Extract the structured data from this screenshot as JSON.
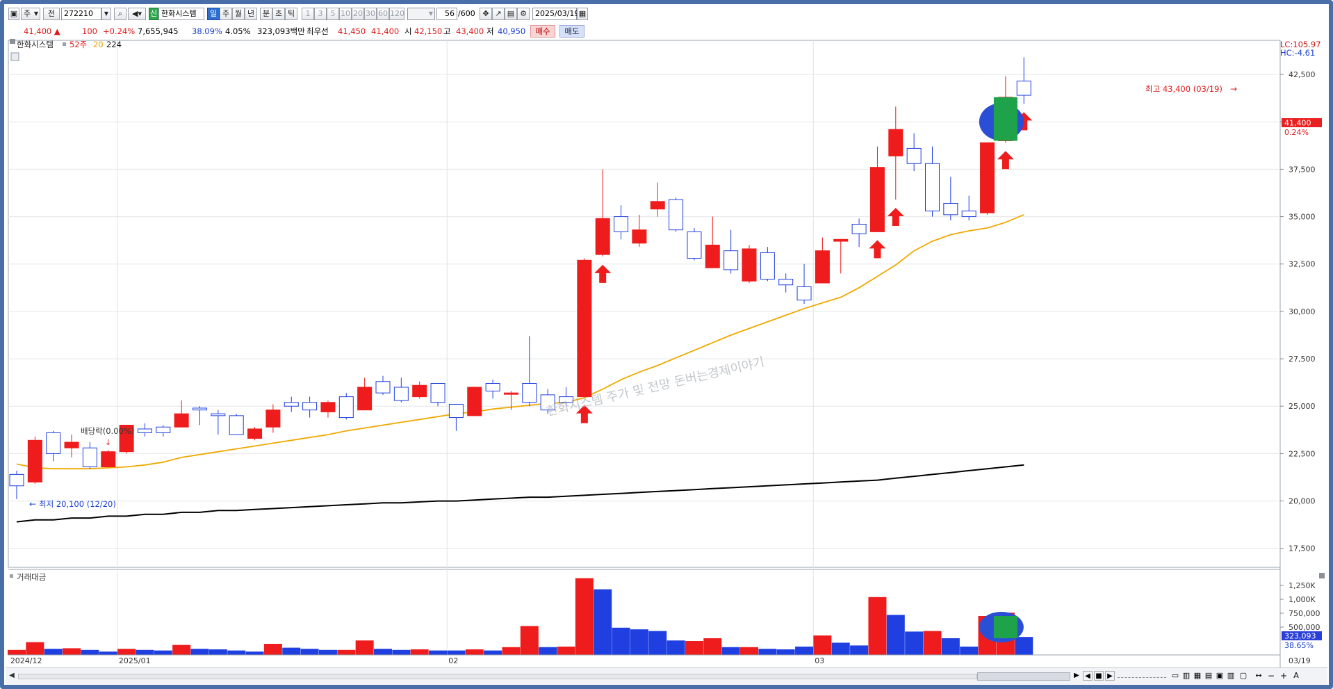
{
  "toolbar": {
    "period_label": "주",
    "market_label": "전",
    "stock_code": "272210",
    "new_badge": "신",
    "stock_name": "한화시스템",
    "timeframes": [
      "일",
      "주",
      "월",
      "년",
      "분",
      "초",
      "틱"
    ],
    "selected_timeframe": "일",
    "intervals": [
      "1",
      "3",
      "5",
      "10",
      "20",
      "30",
      "60",
      "120"
    ],
    "count": "56",
    "count_max": "/600",
    "date": "2025/03/19"
  },
  "quote": {
    "price": "41,400 ▲",
    "change": "100",
    "change_pct": "+0.24%",
    "volume": "7,655,945",
    "volume_ratio": "38.09%",
    "turnover": "4.05%",
    "trade_amount": "323,093백만",
    "priority_label": "최우선",
    "ask": "41,450",
    "bid": "41,400",
    "open_label": "시",
    "open": "42,150",
    "high_label": "고",
    "high": "43,400",
    "low_label": "저",
    "low": "40,950",
    "buy_label": "매수",
    "sell_label": "매도"
  },
  "legend": {
    "stock_name": "한화시스템",
    "series": [
      "52주",
      "20",
      "224"
    ],
    "lc": "LC:105.97",
    "hc": "HC:-4.61"
  },
  "volume_panel": {
    "title": "거래대금",
    "ticks": [
      "1,250K",
      "1,000K",
      "750,000",
      "500,000"
    ],
    "current_value": "323,093",
    "current_pct": "38.65%"
  },
  "annotations": {
    "high_label": "최고 43,400 (03/19)",
    "low_label": "최저 20,100 (12/20)",
    "dividend_label": "배당락(0.00%)",
    "watermark": "한화시스템 주가 및 전망 돈버는경제이야기",
    "price_tag": "41,400",
    "price_tag_pct": "0.24%"
  },
  "colors": {
    "up": "#ee1c1c",
    "down": "#1f3fe0",
    "ma20": "#f0a800",
    "ma224": "#000000",
    "highlight_fill": "#1fa34a",
    "highlight_ring": "#2a4fd6"
  },
  "chart_data": {
    "type": "candlestick",
    "title": "한화시스템",
    "ylim": [
      16500,
      44300
    ],
    "y_ticks": [
      17500,
      20000,
      22500,
      25000,
      27500,
      30000,
      32500,
      35000,
      37500,
      40000,
      42500
    ],
    "x_labels": [
      "2024/12",
      "2025/01",
      "02",
      "03",
      "03/19"
    ],
    "candles": [
      {
        "o": 20800,
        "h": 21600,
        "l": 20100,
        "c": 21400,
        "dir": "down"
      },
      {
        "o": 21000,
        "h": 23400,
        "l": 20900,
        "c": 23200,
        "dir": "up"
      },
      {
        "o": 22500,
        "h": 23700,
        "l": 22100,
        "c": 23600,
        "dir": "down"
      },
      {
        "o": 22800,
        "h": 23500,
        "l": 22300,
        "c": 23100,
        "dir": "up"
      },
      {
        "o": 21800,
        "h": 23100,
        "l": 21700,
        "c": 22800,
        "dir": "down"
      },
      {
        "o": 21800,
        "h": 22700,
        "l": 21800,
        "c": 22600,
        "dir": "up"
      },
      {
        "o": 22600,
        "h": 24000,
        "l": 22500,
        "c": 24000,
        "dir": "up"
      },
      {
        "o": 23600,
        "h": 24100,
        "l": 23400,
        "c": 23800,
        "dir": "down"
      },
      {
        "o": 23600,
        "h": 24000,
        "l": 23400,
        "c": 23900,
        "dir": "down"
      },
      {
        "o": 23900,
        "h": 25300,
        "l": 23900,
        "c": 24600,
        "dir": "up"
      },
      {
        "o": 24800,
        "h": 25000,
        "l": 24000,
        "c": 24900,
        "dir": "down"
      },
      {
        "o": 24500,
        "h": 24800,
        "l": 23500,
        "c": 24600,
        "dir": "down"
      },
      {
        "o": 23500,
        "h": 24600,
        "l": 23500,
        "c": 24500,
        "dir": "down"
      },
      {
        "o": 23300,
        "h": 23900,
        "l": 23200,
        "c": 23800,
        "dir": "up"
      },
      {
        "o": 23900,
        "h": 25100,
        "l": 23600,
        "c": 24800,
        "dir": "up"
      },
      {
        "o": 25000,
        "h": 25500,
        "l": 24700,
        "c": 25200,
        "dir": "down"
      },
      {
        "o": 24800,
        "h": 25500,
        "l": 24400,
        "c": 25200,
        "dir": "down"
      },
      {
        "o": 24700,
        "h": 25300,
        "l": 24400,
        "c": 25200,
        "dir": "up"
      },
      {
        "o": 24400,
        "h": 25700,
        "l": 24300,
        "c": 25500,
        "dir": "down"
      },
      {
        "o": 24800,
        "h": 26500,
        "l": 24800,
        "c": 26000,
        "dir": "up"
      },
      {
        "o": 25700,
        "h": 26600,
        "l": 25600,
        "c": 26300,
        "dir": "down"
      },
      {
        "o": 25300,
        "h": 26500,
        "l": 25200,
        "c": 26000,
        "dir": "down"
      },
      {
        "o": 25500,
        "h": 26300,
        "l": 25400,
        "c": 26100,
        "dir": "up"
      },
      {
        "o": 25200,
        "h": 26200,
        "l": 25000,
        "c": 26200,
        "dir": "down"
      },
      {
        "o": 24400,
        "h": 25000,
        "l": 23700,
        "c": 25100,
        "dir": "down"
      },
      {
        "o": 24500,
        "h": 26000,
        "l": 24500,
        "c": 26000,
        "dir": "up"
      },
      {
        "o": 25800,
        "h": 26400,
        "l": 25400,
        "c": 26200,
        "dir": "down"
      },
      {
        "o": 25700,
        "h": 25800,
        "l": 24800,
        "c": 25700,
        "dir": "up"
      },
      {
        "o": 25200,
        "h": 28700,
        "l": 25000,
        "c": 26200,
        "dir": "down"
      },
      {
        "o": 24800,
        "h": 25900,
        "l": 24600,
        "c": 25600,
        "dir": "down"
      },
      {
        "o": 25200,
        "h": 26000,
        "l": 25000,
        "c": 25500,
        "dir": "down"
      },
      {
        "o": 25500,
        "h": 32800,
        "l": 25500,
        "c": 32700,
        "dir": "up"
      },
      {
        "o": 33000,
        "h": 37500,
        "l": 32900,
        "c": 34900,
        "dir": "up"
      },
      {
        "o": 34200,
        "h": 35600,
        "l": 33800,
        "c": 35000,
        "dir": "down"
      },
      {
        "o": 34300,
        "h": 35100,
        "l": 33400,
        "c": 33600,
        "dir": "up"
      },
      {
        "o": 35400,
        "h": 36800,
        "l": 35000,
        "c": 35800,
        "dir": "up"
      },
      {
        "o": 34300,
        "h": 36000,
        "l": 34200,
        "c": 35900,
        "dir": "down"
      },
      {
        "o": 32800,
        "h": 34400,
        "l": 32700,
        "c": 34200,
        "dir": "down"
      },
      {
        "o": 33500,
        "h": 35000,
        "l": 32300,
        "c": 32300,
        "dir": "up"
      },
      {
        "o": 32200,
        "h": 34300,
        "l": 32000,
        "c": 33200,
        "dir": "down"
      },
      {
        "o": 33300,
        "h": 33500,
        "l": 31500,
        "c": 31600,
        "dir": "up"
      },
      {
        "o": 31700,
        "h": 33400,
        "l": 31600,
        "c": 33100,
        "dir": "down"
      },
      {
        "o": 31400,
        "h": 32000,
        "l": 31000,
        "c": 31700,
        "dir": "down"
      },
      {
        "o": 30600,
        "h": 32500,
        "l": 30400,
        "c": 31300,
        "dir": "down"
      },
      {
        "o": 31500,
        "h": 33900,
        "l": 31500,
        "c": 33200,
        "dir": "up"
      },
      {
        "o": 33700,
        "h": 33800,
        "l": 32000,
        "c": 33800,
        "dir": "up"
      },
      {
        "o": 34100,
        "h": 34900,
        "l": 33400,
        "c": 34600,
        "dir": "down"
      },
      {
        "o": 34200,
        "h": 38700,
        "l": 34200,
        "c": 37600,
        "dir": "up"
      },
      {
        "o": 38200,
        "h": 40800,
        "l": 35900,
        "c": 39600,
        "dir": "up"
      },
      {
        "o": 37800,
        "h": 39400,
        "l": 37400,
        "c": 38600,
        "dir": "down"
      },
      {
        "o": 35300,
        "h": 38700,
        "l": 35000,
        "c": 37800,
        "dir": "down"
      },
      {
        "o": 35100,
        "h": 37100,
        "l": 34800,
        "c": 35700,
        "dir": "down"
      },
      {
        "o": 35000,
        "h": 36100,
        "l": 34800,
        "c": 35300,
        "dir": "down"
      },
      {
        "o": 35200,
        "h": 38900,
        "l": 35100,
        "c": 38900,
        "dir": "up"
      },
      {
        "o": 39000,
        "h": 42400,
        "l": 38900,
        "c": 41300,
        "dir": "up"
      },
      {
        "o": 41400,
        "h": 43400,
        "l": 40950,
        "c": 42150,
        "dir": "down"
      }
    ],
    "ma20": [
      21950,
      21750,
      21700,
      21700,
      21700,
      21750,
      21800,
      21900,
      22050,
      22300,
      22450,
      22600,
      22750,
      22900,
      23050,
      23200,
      23350,
      23500,
      23700,
      23850,
      24000,
      24150,
      24300,
      24450,
      24600,
      24700,
      24850,
      24950,
      25050,
      25150,
      25200,
      25450,
      25900,
      26400,
      26800,
      27150,
      27550,
      27950,
      28350,
      28750,
      29100,
      29450,
      29800,
      30150,
      30450,
      30750,
      31250,
      31850,
      32450,
      33200,
      33700,
      34050,
      34250,
      34400,
      34700,
      35100
    ],
    "ma224": [
      18900,
      19000,
      19000,
      19100,
      19100,
      19200,
      19200,
      19300,
      19300,
      19400,
      19400,
      19500,
      19500,
      19550,
      19600,
      19650,
      19700,
      19750,
      19800,
      19850,
      19900,
      19900,
      19950,
      20000,
      20000,
      20050,
      20100,
      20150,
      20200,
      20200,
      20250,
      20300,
      20350,
      20400,
      20450,
      20500,
      20550,
      20600,
      20650,
      20700,
      20750,
      20800,
      20850,
      20900,
      20950,
      21000,
      21050,
      21100,
      21200,
      21300,
      21400,
      21500,
      21600,
      21700,
      21800,
      21900
    ],
    "volume": [
      {
        "v": 90000,
        "dir": "up"
      },
      {
        "v": 230000,
        "dir": "up"
      },
      {
        "v": 110000,
        "dir": "down"
      },
      {
        "v": 120000,
        "dir": "up"
      },
      {
        "v": 90000,
        "dir": "down"
      },
      {
        "v": 60000,
        "dir": "down"
      },
      {
        "v": 110000,
        "dir": "up"
      },
      {
        "v": 90000,
        "dir": "down"
      },
      {
        "v": 80000,
        "dir": "down"
      },
      {
        "v": 180000,
        "dir": "up"
      },
      {
        "v": 110000,
        "dir": "down"
      },
      {
        "v": 100000,
        "dir": "down"
      },
      {
        "v": 80000,
        "dir": "down"
      },
      {
        "v": 60000,
        "dir": "down"
      },
      {
        "v": 200000,
        "dir": "up"
      },
      {
        "v": 130000,
        "dir": "down"
      },
      {
        "v": 110000,
        "dir": "down"
      },
      {
        "v": 90000,
        "dir": "down"
      },
      {
        "v": 90000,
        "dir": "up"
      },
      {
        "v": 260000,
        "dir": "up"
      },
      {
        "v": 110000,
        "dir": "down"
      },
      {
        "v": 90000,
        "dir": "down"
      },
      {
        "v": 100000,
        "dir": "up"
      },
      {
        "v": 80000,
        "dir": "down"
      },
      {
        "v": 80000,
        "dir": "down"
      },
      {
        "v": 100000,
        "dir": "up"
      },
      {
        "v": 80000,
        "dir": "down"
      },
      {
        "v": 140000,
        "dir": "up"
      },
      {
        "v": 520000,
        "dir": "up"
      },
      {
        "v": 140000,
        "dir": "down"
      },
      {
        "v": 150000,
        "dir": "up"
      },
      {
        "v": 1380000,
        "dir": "up"
      },
      {
        "v": 1180000,
        "dir": "down"
      },
      {
        "v": 490000,
        "dir": "down"
      },
      {
        "v": 460000,
        "dir": "down"
      },
      {
        "v": 430000,
        "dir": "down"
      },
      {
        "v": 260000,
        "dir": "down"
      },
      {
        "v": 250000,
        "dir": "up"
      },
      {
        "v": 300000,
        "dir": "up"
      },
      {
        "v": 140000,
        "dir": "down"
      },
      {
        "v": 140000,
        "dir": "up"
      },
      {
        "v": 110000,
        "dir": "down"
      },
      {
        "v": 100000,
        "dir": "down"
      },
      {
        "v": 150000,
        "dir": "down"
      },
      {
        "v": 350000,
        "dir": "up"
      },
      {
        "v": 220000,
        "dir": "down"
      },
      {
        "v": 170000,
        "dir": "down"
      },
      {
        "v": 1040000,
        "dir": "up"
      },
      {
        "v": 720000,
        "dir": "down"
      },
      {
        "v": 420000,
        "dir": "down"
      },
      {
        "v": 430000,
        "dir": "up"
      },
      {
        "v": 300000,
        "dir": "down"
      },
      {
        "v": 150000,
        "dir": "down"
      },
      {
        "v": 700000,
        "dir": "up"
      },
      {
        "v": 760000,
        "dir": "up"
      },
      {
        "v": 323093,
        "dir": "down"
      }
    ],
    "volume_ylim": [
      0,
      1450000
    ],
    "volume_ticks": [
      500000,
      750000,
      1000000,
      1250000
    ]
  }
}
